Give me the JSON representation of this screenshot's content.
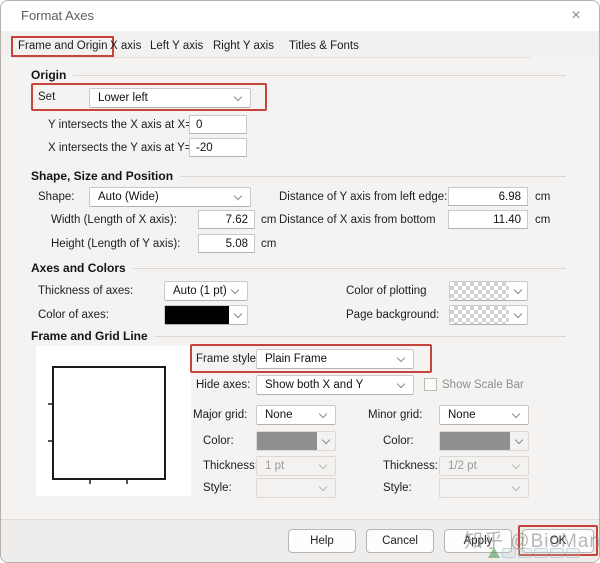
{
  "window": {
    "title": "Format Axes",
    "close_glyph": "×"
  },
  "tabs": [
    {
      "label": "Frame and Origin",
      "active": true
    },
    {
      "label": "X axis",
      "active": false
    },
    {
      "label": "Left Y axis",
      "active": false
    },
    {
      "label": "Right Y axis",
      "active": false
    },
    {
      "label": "Titles & Fonts",
      "active": false
    }
  ],
  "origin": {
    "header": "Origin",
    "set_label": "Set",
    "set_value": "Lower left",
    "y_label": "Y intersects the X axis at X=",
    "y_value": "0",
    "x_label": "X intersects the Y axis at Y=",
    "x_value": "-20"
  },
  "shape": {
    "header": "Shape, Size and Position",
    "shape_label": "Shape:",
    "shape_value": "Auto (Wide)",
    "width_label": "Width (Length of X axis):",
    "width_value": "7.62",
    "height_label": "Height (Length of Y axis):",
    "height_value": "5.08",
    "dist_y_label": "Distance of Y axis from left edge:",
    "dist_y_value": "6.98",
    "dist_x_label": "Distance of X axis from bottom",
    "dist_x_value": "11.40",
    "unit_cm": "cm"
  },
  "axes_colors": {
    "header": "Axes and Colors",
    "thickness_label": "Thickness of axes:",
    "thickness_value": "Auto (1 pt)",
    "color_axes_label": "Color of axes:",
    "axes_color": "#000000",
    "color_plotting_label": "Color of plotting",
    "page_background_label": "Page background:"
  },
  "frame_grid": {
    "header": "Frame and Grid Line",
    "frame_style_label": "Frame style:",
    "frame_style_value": "Plain Frame",
    "hide_axes_label": "Hide axes:",
    "hide_axes_value": "Show both X and Y",
    "scale_bar_label": "Show Scale Bar",
    "major_label": "Major grid:",
    "major_value": "None",
    "minor_label": "Minor grid:",
    "minor_value": "None",
    "color_label": "Color:",
    "thickness_label": "Thickness:",
    "major_thickness_value": "1 pt",
    "minor_thickness_value": "1/2 pt",
    "style_label": "Style:",
    "grid_color": "#8f8f8f"
  },
  "buttons": {
    "help": "Help",
    "cancel": "Cancel",
    "apply": "Apply",
    "ok": "OK"
  },
  "watermark": {
    "text": "知乎 @BioMan"
  },
  "annotation_color": "#c5453d"
}
